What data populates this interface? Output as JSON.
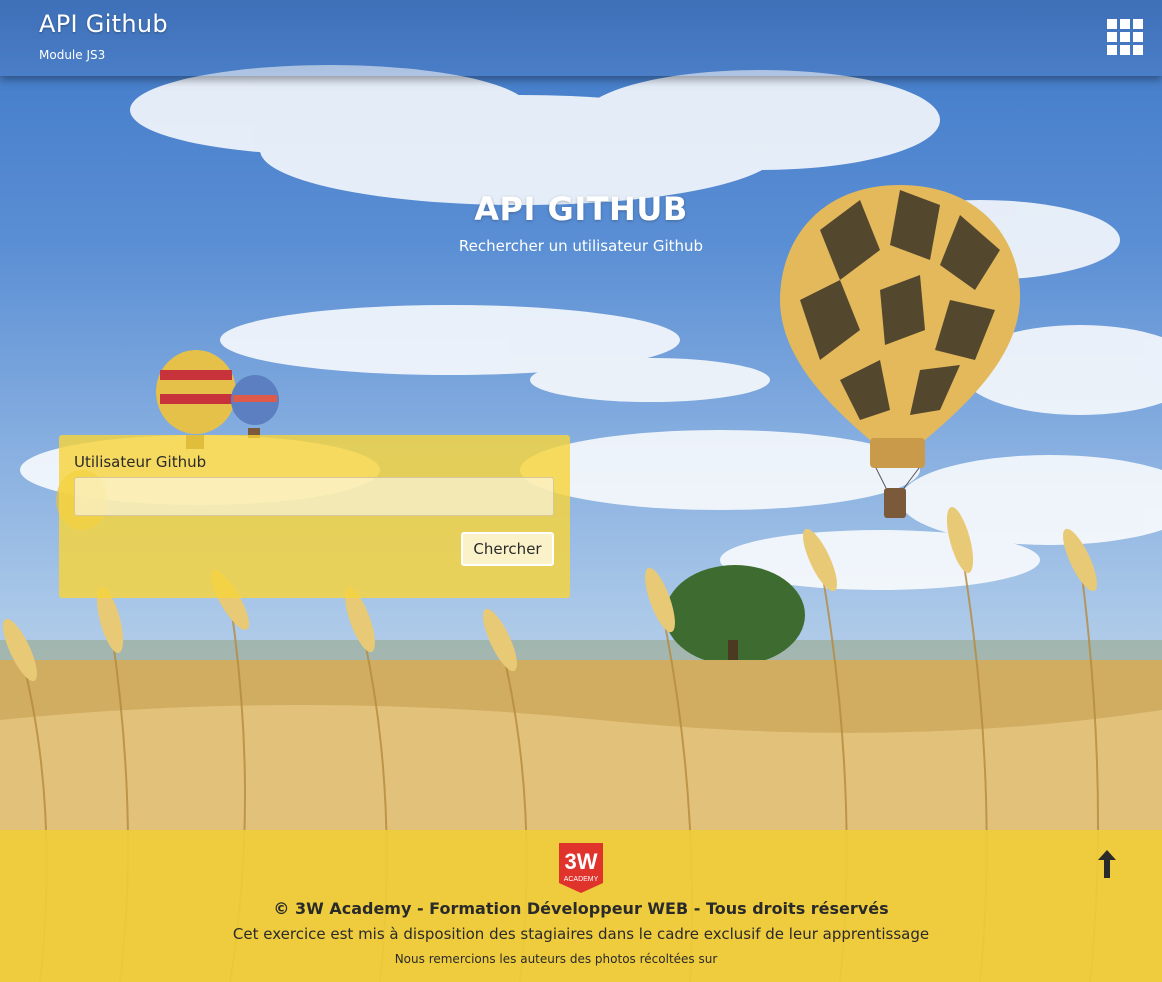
{
  "header": {
    "title": "API Github",
    "subtitle": "Module JS3",
    "menu_icon": "grid-icon"
  },
  "hero": {
    "title": "API GITHUB",
    "subtitle": "Rechercher un utilisateur Github"
  },
  "form": {
    "label": "Utilisateur Github",
    "input_value": "",
    "input_placeholder": "",
    "button_label": "Chercher"
  },
  "footer": {
    "logo_text_top": "3W",
    "logo_text_bottom": "ACADEMY",
    "copyright": "© 3W Academy - Formation Développeur WEB - Tous droits réservés",
    "notice": "Cet exercice est mis à disposition des stagiaires dans le cadre exclusif de leur apprentissage",
    "credits": "Nous remercions les auteurs des photos récoltées sur",
    "back_to_top_icon": "arrow-up-icon"
  },
  "colors": {
    "card_yellow": "#f6d43c",
    "footer_yellow": "#f0cd37",
    "logo_red": "#e0332b",
    "header_text": "#ffffff"
  }
}
